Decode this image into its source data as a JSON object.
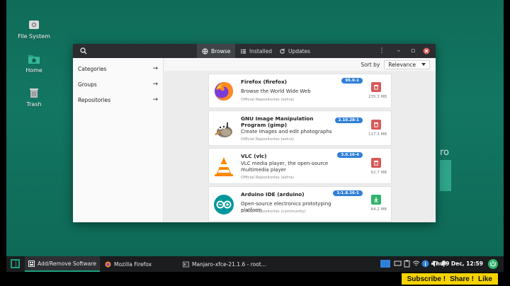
{
  "desktop": {
    "icons": [
      {
        "label": "File System",
        "icon": "drive-icon"
      },
      {
        "label": "Home",
        "icon": "home-folder-icon"
      },
      {
        "label": "Trash",
        "icon": "trash-icon"
      }
    ],
    "background_text": "ro"
  },
  "app": {
    "tabs": [
      {
        "label": "Browse",
        "icon": "globe-icon",
        "active": true
      },
      {
        "label": "Installed",
        "icon": "list-icon",
        "active": false
      },
      {
        "label": "Updates",
        "icon": "refresh-icon",
        "active": false
      }
    ],
    "window_controls": {
      "menu": "⋮",
      "minimize": "–",
      "maximize": "▫",
      "close": "✕"
    },
    "sidebar": [
      {
        "label": "Categories",
        "arrow": "→"
      },
      {
        "label": "Groups",
        "arrow": "→"
      },
      {
        "label": "Repositories",
        "arrow": "→"
      }
    ],
    "sort": {
      "label": "Sort by",
      "value": "Relevance"
    },
    "packages": [
      {
        "name": "Firefox (firefox)",
        "version": "95.0-1",
        "description": "Browse the World Wide Web",
        "repo": "Official Repositories (extra)",
        "action": "remove",
        "size": "235.3 MB"
      },
      {
        "name": "GNU Image Manipulation Program (gimp)",
        "version": "2.10.28-1",
        "description": "Create images and edit photographs",
        "repo": "Official Repositories (extra)",
        "action": "remove",
        "size": "117.3 MB"
      },
      {
        "name": "VLC (vlc)",
        "version": "3.0.16-4",
        "description": "VLC media player, the open-source multimedia player",
        "repo": "Official Repositories (extra)",
        "action": "remove",
        "size": "62.7 MB"
      },
      {
        "name": "Arduino IDE (arduino)",
        "version": "1:1.8.16-1",
        "description": "Open-source electronics prototyping platform",
        "repo": "Official Repositories (community)",
        "action": "install",
        "size": "64.2 MB"
      }
    ]
  },
  "taskbar": {
    "tasks": [
      {
        "label": "Add/Remove Software",
        "active": true
      },
      {
        "label": "Mozilla Firefox",
        "active": false
      },
      {
        "label": "Manjaro-xfce-21.1.6 - root...",
        "active": false
      }
    ],
    "clock": "Thu  9 Dec, 12:59"
  },
  "promo": {
    "items": [
      "Subscribe !",
      "Share !",
      "Like"
    ]
  },
  "colors": {
    "accent": "#1fa07f",
    "desktop": "#127663",
    "version_badge": "#2f7fd8",
    "remove": "#d65a5a",
    "install": "#2fb36b",
    "promo": "#f6d300"
  }
}
